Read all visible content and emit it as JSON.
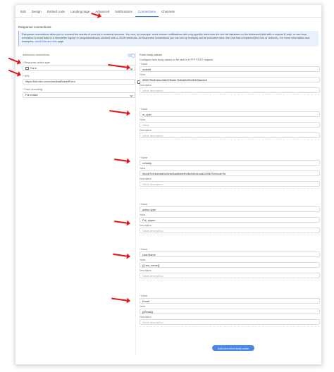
{
  "tabs": [
    {
      "label": "Edit",
      "active": false
    },
    {
      "label": "Design",
      "active": false
    },
    {
      "label": "Embed code",
      "active": false
    },
    {
      "label": "Landing page",
      "active": false
    },
    {
      "label": "Advanced",
      "active": false
    },
    {
      "label": "Notifications",
      "active": false
    },
    {
      "label": "Connections",
      "active": true
    },
    {
      "label": "Channels",
      "active": false
    }
  ],
  "section_title": "Response connections",
  "alert": {
    "text": "Response connections allow you to connect the results of your bot to external services. You can, for example, send custom notifications with only specific data from the bot via Variables on the Advanced field with a custom E-mail, or use form emulation to send data to a newsletter signup or programmatically connect with a JSON webhook. All Response connections you can set up multiple) will be executed when the chat has completed (the End or redirect). For more information and examples,",
    "link": "check this and this",
    "tail": "page."
  },
  "settings": {
    "advanced_label": "Advanced connections",
    "response_type_label": "* Response action type",
    "response_type_value": "Form",
    "url_label": "* URL",
    "url_value": "https://link.intro.com/cms/leadSubmitForm",
    "encoding_label": "* Form encoding",
    "encoding_value": "Form data"
  },
  "form_body": {
    "title": "Form body values",
    "subtitle": "Configure form body values to be sent in HTTP POST request",
    "name_label": "* Name",
    "value_label": "Value",
    "description_label": "Description",
    "description_placeholder": "Value description",
    "value_placeholder": "Value",
    "entries": [
      {
        "name": "orderId",
        "value": "0f0f57f9d4fd4ec3d622fbdde7bd0a8b5f1d9f483aede6",
        "description": ""
      },
      {
        "name": "m_cpid",
        "value": "",
        "description": ""
      },
      {
        "name": "vrNotify",
        "value": "0fcd4f7e04dedde0d3ebe0ad8ebb9b4be0d4eecad22f3fb7f1b0cde7fd",
        "description": ""
      },
      {
        "name": "action-type",
        "value": "Fbl_qhpeu",
        "description": ""
      },
      {
        "name": "Last Name",
        "value": "{{Last_name}}",
        "description": ""
      },
      {
        "name": "Email",
        "value": "{{Email}}",
        "description": ""
      }
    ],
    "add_button": "Add new form body value"
  },
  "colors": {
    "accent": "#2f6fde",
    "arrow": "#e0161b",
    "button": "#4a86e8"
  }
}
